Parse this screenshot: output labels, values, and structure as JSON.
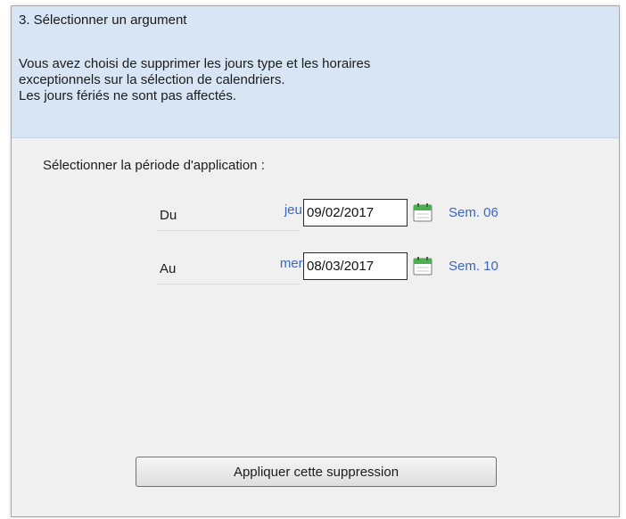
{
  "step": {
    "title": "3. Sélectionner un argument",
    "description_lines": [
      "Vous avez choisi de supprimer les jours type et les horaires",
      "exceptionnels sur la sélection de calendriers.",
      "Les jours fériés ne sont pas affectés."
    ]
  },
  "period": {
    "label": "Sélectionner la période d'application :",
    "from": {
      "label": "Du",
      "day": "jeu.",
      "date": "09/02/2017",
      "week": "Sem. 06",
      "icon": "calendar-icon"
    },
    "to": {
      "label": "Au",
      "day": "mer.",
      "date": "08/03/2017",
      "week": "Sem. 10",
      "icon": "calendar-icon"
    }
  },
  "actions": {
    "apply_label": "Appliquer cette suppression"
  },
  "colors": {
    "header_bg": "#d7e5f5",
    "panel_bg": "#f0f0f0",
    "accent_text": "#3a66c4"
  }
}
